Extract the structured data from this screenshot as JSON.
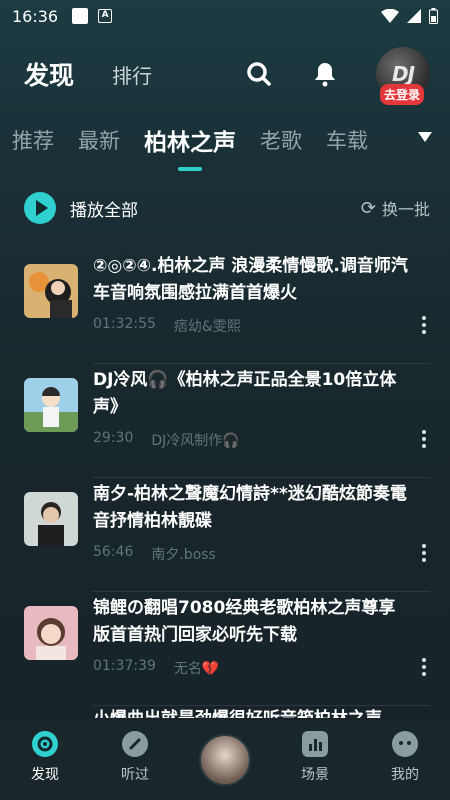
{
  "status_bar": {
    "time": "16:36",
    "a_icon": "A"
  },
  "header": {
    "tab_discover": "发现",
    "tab_rank": "排行",
    "avatar_text": "DJ",
    "login_badge": "去登录"
  },
  "categories": [
    "推荐",
    "最新",
    "柏林之声",
    "老歌",
    "车载"
  ],
  "play_all": {
    "label": "播放全部",
    "refresh_label": "换一批"
  },
  "songs": [
    {
      "title": "②◎②④.柏林之声 浪漫柔情慢歌.调音师汽车音响氛围感拉满首首爆火",
      "duration": "01:32:55",
      "artist": "痞幼&雯熙"
    },
    {
      "title": "DJ冷风🎧《柏林之声正品全景10倍立体声》",
      "duration": "29:30",
      "artist": "DJ冷风制作🎧"
    },
    {
      "title": "南夕-柏林之聲魔幻情詩**迷幻酷炫節奏電音抒情柏林靚碟",
      "duration": "56:46",
      "artist": "南夕.boss"
    },
    {
      "title": "锦鲤の翻唱7080经典老歌柏林之声尊享版首首热门回家必听先下载",
      "duration": "01:37:39",
      "artist": "无名💔"
    }
  ],
  "partial_title": "小爆曲出就是劲爆很好听音箱柏林之声",
  "bottom_nav": [
    {
      "label": "发现",
      "icon": "discover-icon"
    },
    {
      "label": "听过",
      "icon": "history-icon"
    },
    {
      "label": "",
      "icon": "now-playing-avatar"
    },
    {
      "label": "场景",
      "icon": "scene-icon"
    },
    {
      "label": "我的",
      "icon": "profile-icon"
    }
  ],
  "colors": {
    "accent": "#2fd0cf",
    "badge": "#e5363a",
    "bg": "#18282d"
  }
}
